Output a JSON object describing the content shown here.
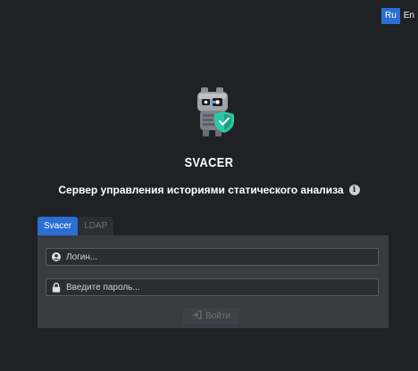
{
  "language_switch": {
    "ru_label": "Ru",
    "en_label": "En",
    "active": "Ru"
  },
  "header": {
    "app_name": "SVACER",
    "subtitle": "Сервер управления историями статического анализа",
    "info_icon": "info-circle-icon",
    "logo_icon": "robot-mascot-with-shield-icon"
  },
  "tabs": [
    {
      "label": "Svacer",
      "active": true
    },
    {
      "label": "LDAP",
      "active": false
    }
  ],
  "form": {
    "login_placeholder": "Логин...",
    "login_value": "",
    "login_icon": "user-icon",
    "password_placeholder": "Введите пароль...",
    "password_value": "",
    "password_icon": "lock-icon",
    "submit_label": "Войти",
    "submit_icon": "sign-in-icon"
  },
  "colors": {
    "background": "#1f2125",
    "panel": "#383b40",
    "accent": "#2a6fd1",
    "shield": "#2bc8a6"
  }
}
